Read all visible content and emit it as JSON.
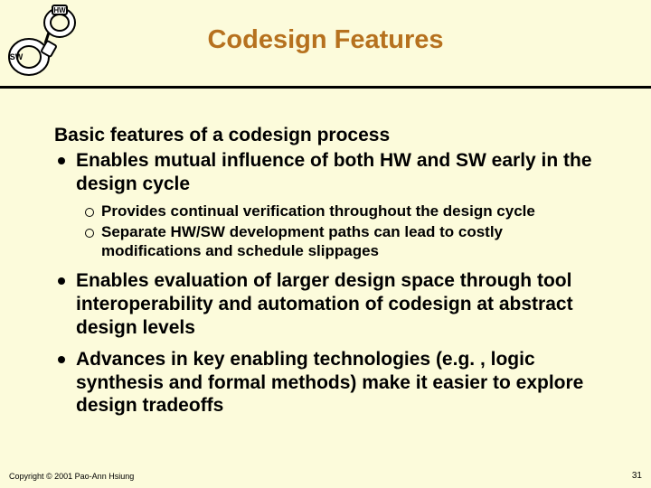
{
  "logo": {
    "hw": "HW",
    "sw": "SW"
  },
  "title": "Codesign Features",
  "heading": "Basic features of a codesign process",
  "bullets": {
    "b1": "Enables mutual influence of both HW and SW early in the design cycle",
    "b1a": "Provides continual verification throughout the design cycle",
    "b1b": "Separate HW/SW development paths can lead to costly modifications and schedule slippages",
    "b2": "Enables evaluation of larger design space through tool interoperability and automation of codesign at abstract design levels",
    "b3": "Advances in key enabling technologies (e.g. , logic synthesis and formal methods) make it easier to explore design tradeoffs"
  },
  "footer": {
    "copyright": "Copyright © 2001 Pao-Ann Hsiung",
    "page": "31"
  }
}
